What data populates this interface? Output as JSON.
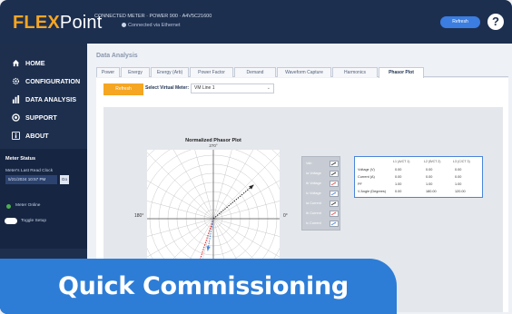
{
  "app": {
    "logo_part1": "FLEX",
    "logo_part2": "Point",
    "connection_line1": "CONNECTED METER · POWER 900 · A4V5C21600",
    "connection_line2": "Connected via Ethernet",
    "top_button": "Refresh",
    "help_label": "?"
  },
  "sidebar": {
    "items": [
      {
        "label": "HOME",
        "icon": "home-icon"
      },
      {
        "label": "CONFIGURATION",
        "icon": "gear-icon"
      },
      {
        "label": "DATA ANALYSIS",
        "icon": "bar-chart-icon"
      },
      {
        "label": "SUPPORT",
        "icon": "support-icon"
      },
      {
        "label": "ABOUT",
        "icon": "info-icon"
      }
    ],
    "status": {
      "title": "Meter Status",
      "last_read_label": "Meter's Last Read Clock",
      "last_read_value": "5/21/2024 10:57 PM",
      "go_label": "Go",
      "meter_label": "Meter Online",
      "toggle_label": "Toggle Setup"
    }
  },
  "main": {
    "title": "Data Analysis",
    "tabs": [
      "Power",
      "Energy",
      "Energy (Arb)",
      "Power Factor",
      "Demand",
      "Waveform Capture",
      "Harmonics",
      "Phasor Plot"
    ],
    "active_tab": "Phasor Plot",
    "action_button": "Refresh",
    "select_label": "Select Virtual Meter:",
    "select_value": "VM Line 1"
  },
  "plot": {
    "title": "Normalized Phasor Plot",
    "top_label": "270°",
    "left_label": "180°",
    "right_label": "0°"
  },
  "legend": {
    "items": [
      {
        "label": "Vab",
        "color": "#333333"
      },
      {
        "label": "Ia Voltage",
        "color": "#333333"
      },
      {
        "label": "Ib Voltage",
        "color": "#e05050"
      },
      {
        "label": "Ic Voltage",
        "color": "#4a86d8"
      },
      {
        "label": "Ia Current",
        "color": "#333333"
      },
      {
        "label": "Ib Current",
        "color": "#e05050"
      },
      {
        "label": "Ic Current",
        "color": "#4a86d8"
      }
    ]
  },
  "table": {
    "headers": [
      "",
      "L1 (A/CT 1)",
      "L2 (B/CT 2)",
      "L3 (C/CT 3)"
    ],
    "rows": [
      [
        "Voltage (V)",
        "0.00",
        "0.00",
        "0.00"
      ],
      [
        "Current (A)",
        "0.00",
        "0.00",
        "0.00"
      ],
      [
        "PF",
        "1.00",
        "1.00",
        "1.00"
      ],
      [
        "V Angle (Degrees)",
        "0.00",
        "180.00",
        "120.00"
      ]
    ]
  },
  "phasors": {
    "black_angle_deg": 40,
    "red_angle_deg": 252,
    "blue_angle_deg": 260
  },
  "banner": {
    "text": "Quick Commissioning"
  }
}
